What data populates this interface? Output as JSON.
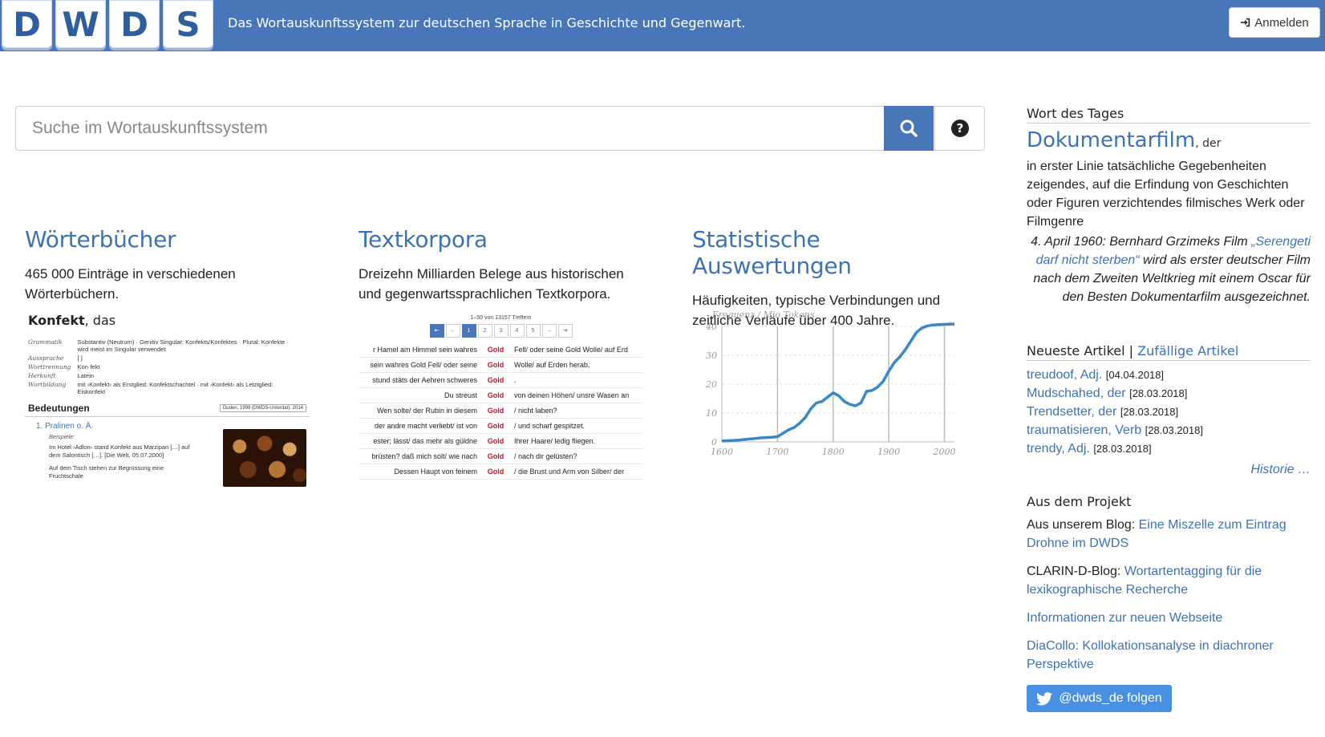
{
  "header": {
    "logo_letters": [
      "D",
      "W",
      "D",
      "S"
    ],
    "tagline": "Das Wortauskunftssystem zur deutschen Sprache in Geschichte und Gegenwart.",
    "login_label": "Anmelden",
    "login_icon": "sign-in-icon",
    "bar_color": "#4876b9"
  },
  "search": {
    "placeholder": "Suche im Wortauskunftssystem",
    "value": "",
    "submit_icon": "search-icon",
    "help_icon": "question-circle-icon"
  },
  "sections": [
    {
      "title": "Wörterbücher",
      "text": "465 000 Einträge in verschiedenen Wörterbüchern."
    },
    {
      "title": "Textkorpora",
      "text": "Dreizehn Milliarden Belege aus historischen und gegenwartssprachlichen Textkorpora."
    },
    {
      "title": "Statistische Auswertungen",
      "text": "Häufigkeiten, typische Verbindungen und zeitliche Verläufe über 400 Jahre."
    }
  ],
  "dict_preview": {
    "headword": "Konfekt",
    "article": ", das",
    "rows": [
      {
        "key": "Grammatik",
        "val": "Substantiv (Neutrum) · Genitiv Singular: Konfekts/Konfektes · Plural: Konfekte · wird meist im Singular verwendet"
      },
      {
        "key": "Aussprache",
        "val": "[ ]"
      },
      {
        "key": "Worttrennung",
        "val": "Kon·fekt"
      },
      {
        "key": "Herkunft",
        "val": "Latein"
      },
      {
        "key": "Wortbildung",
        "val": "mit ›Konfekt‹ als Erstglied: Konfektschachtel · mit ›Konfekt‹ als Letztglied: Eiskonfekt"
      }
    ],
    "meanings_label": "Bedeutungen",
    "source_badge": "Duden, 1999 (DWDS-Unterdat), 2014",
    "sense": "1.   Pralinen o. Ä.",
    "example_label": "Beispiele:",
    "examples": [
      "Im Hotel ›Adlon‹ stand Konfekt aus Marzipan […] auf dem Salontisch […]. [Die Welt, 05.07.2000]",
      "Auf dem Tisch stehen zur Begrüssung eine Fruchtschale"
    ]
  },
  "corpus_preview": {
    "hits": "1–50 von 13157 Treffern",
    "pager": [
      "⇤",
      "←",
      "1",
      "2",
      "3",
      "4",
      "5",
      "→",
      "⇥"
    ],
    "rows": [
      {
        "left": "r Hamel am Himmel sein wahres",
        "kw": "Gold",
        "right": "Fell/ oder seine Gold Wolle/ auf Erd"
      },
      {
        "left": "sein wahres Gold Fell/ oder seine",
        "kw": "Gold",
        "right": "Wolle/ auf Erden herab."
      },
      {
        "left": "stund stäts der Aehren schweres",
        "kw": "Gold",
        "right": "."
      },
      {
        "left": "Du streust",
        "kw": "Gold",
        "right": "von deinen Höhen/ unsre Wasen an"
      },
      {
        "left": "Wen solte/ der Rubin in diesem",
        "kw": "Gold",
        "right": "/ nicht laben?"
      },
      {
        "left": "der andre macht verliebt/ ist von",
        "kw": "Gold",
        "right": "/ und scharf gespitzet."
      },
      {
        "left": "ester; lässt/ das mehr als güldne",
        "kw": "Gold",
        "right": "Ihrer Haare/ ledig fliegen."
      },
      {
        "left": "brüsten? daß mich solt/ wie nach",
        "kw": "Gold",
        "right": "/ nach dir gelüsten?"
      },
      {
        "left": "Dessen Haupt von feinem",
        "kw": "Gold",
        "right": "/ die Brust und Arm von Silber/ der"
      }
    ]
  },
  "chart_data": {
    "type": "line",
    "title": "",
    "ylabel": "Frequenz / Mio Tokens",
    "xlabel": "",
    "xlim": [
      1600,
      2018
    ],
    "ylim": [
      0,
      40
    ],
    "x_ticks": [
      1600,
      1700,
      1800,
      1900,
      2000
    ],
    "y_ticks": [
      0,
      10,
      20,
      30,
      40
    ],
    "color": "#3a87c8",
    "series": [
      {
        "x": [
          1600,
          1610,
          1620,
          1630,
          1640,
          1650,
          1660,
          1670,
          1680,
          1690,
          1700,
          1710,
          1720,
          1730,
          1740,
          1750,
          1760,
          1770,
          1780,
          1790,
          1800,
          1810,
          1820,
          1830,
          1840,
          1850,
          1860,
          1870,
          1880,
          1890,
          1900,
          1910,
          1920,
          1930,
          1940,
          1950,
          1960,
          1970,
          1980,
          1990,
          2000,
          2010,
          2018
        ],
        "y": [
          0.3,
          0.4,
          0.5,
          0.6,
          0.8,
          1.0,
          1.2,
          1.4,
          1.5,
          1.6,
          1.8,
          3.0,
          4.2,
          5.0,
          6.5,
          8.5,
          11.5,
          13.5,
          14.0,
          15.5,
          17.0,
          16.0,
          14.0,
          13.0,
          12.5,
          13.5,
          17.5,
          17.8,
          19.0,
          21.0,
          24.5,
          27.5,
          29.5,
          32.0,
          35.0,
          38.0,
          39.5,
          40.2,
          40.5,
          40.6,
          40.7,
          40.8,
          40.8
        ]
      }
    ]
  },
  "sidebar": {
    "wdt_title": "Wort des Tages",
    "wdt_word": "Dokumentarfilm",
    "wdt_article": ", der",
    "wdt_definition": "in erster Linie tatsächliche Gegebenheiten zeigendes, auf die Erfindung von Geschichten oder Figuren verzichtendes filmisches Werk oder Filmgenre",
    "wdt_citation_pre": "4. April 1960: Bernhard Grzimeks Film ",
    "wdt_citation_link": "„Serengeti darf nicht sterben“",
    "wdt_citation_post": " wird als erster deutscher Film nach dem Zweiten Weltkrieg mit einem Oscar für den Besten Dokumentarfilm ausgezeichnet.",
    "newest_label": "Neueste Artikel",
    "separator": " | ",
    "random_label": "Zufällige Artikel",
    "articles": [
      {
        "word": "treudoof, Adj.",
        "date": "[04.04.2018]"
      },
      {
        "word": "Mudschahed, der",
        "date": "[28.03.2018]"
      },
      {
        "word": "Trendsetter, der",
        "date": "[28.03.2018]"
      },
      {
        "word": "traumatisieren, Verb",
        "date": "[28.03.2018]"
      },
      {
        "word": "trendy, Adj.",
        "date": "[28.03.2018]"
      }
    ],
    "history_label": "Historie …",
    "project_title": "Aus dem Projekt",
    "project": [
      {
        "pre": "Aus unserem Blog: ",
        "link": "Eine Miszelle zum Eintrag Drohne im DWDS"
      },
      {
        "pre": "CLARIN-D-Blog: ",
        "link": "Wortartentagging für die lexikographische Recherche"
      },
      {
        "pre": "",
        "link": "Informationen zur neuen Webseite"
      },
      {
        "pre": "",
        "link": "DiaCollo: Kollokationsanalyse in diachroner Perspektive"
      }
    ],
    "twitter_label": "@dwds_de folgen",
    "twitter_icon": "twitter-icon"
  }
}
